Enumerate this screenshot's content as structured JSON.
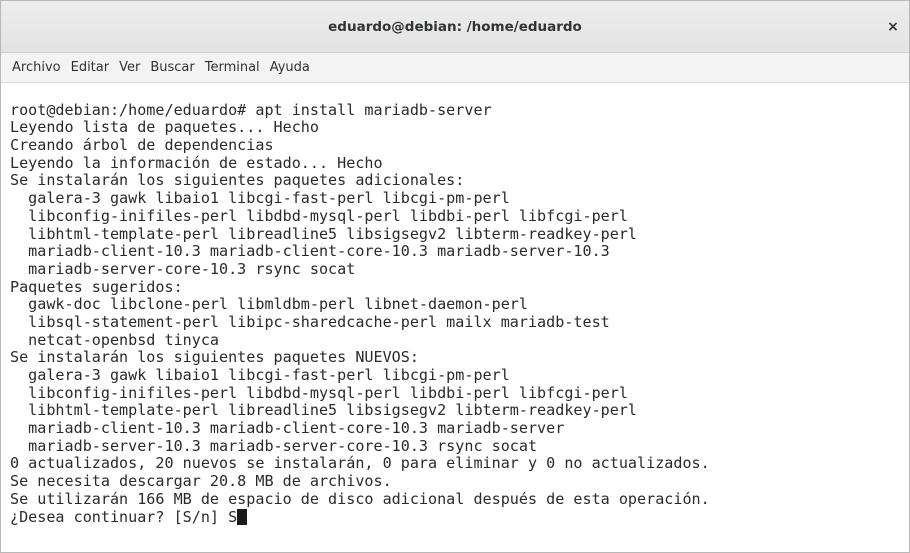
{
  "window": {
    "title": "eduardo@debian: /home/eduardo",
    "close_icon": "close-icon",
    "close_glyph": "×"
  },
  "menu": [
    {
      "label": "Archivo"
    },
    {
      "label": "Editar"
    },
    {
      "label": "Ver"
    },
    {
      "label": "Buscar"
    },
    {
      "label": "Terminal"
    },
    {
      "label": "Ayuda"
    }
  ],
  "terminal": {
    "lines": [
      "root@debian:/home/eduardo# apt install mariadb-server",
      "Leyendo lista de paquetes... Hecho",
      "Creando árbol de dependencias",
      "Leyendo la información de estado... Hecho",
      "Se instalarán los siguientes paquetes adicionales:",
      "  galera-3 gawk libaio1 libcgi-fast-perl libcgi-pm-perl",
      "  libconfig-inifiles-perl libdbd-mysql-perl libdbi-perl libfcgi-perl",
      "  libhtml-template-perl libreadline5 libsigsegv2 libterm-readkey-perl",
      "  mariadb-client-10.3 mariadb-client-core-10.3 mariadb-server-10.3",
      "  mariadb-server-core-10.3 rsync socat",
      "Paquetes sugeridos:",
      "  gawk-doc libclone-perl libmldbm-perl libnet-daemon-perl",
      "  libsql-statement-perl libipc-sharedcache-perl mailx mariadb-test",
      "  netcat-openbsd tinyca",
      "Se instalarán los siguientes paquetes NUEVOS:",
      "  galera-3 gawk libaio1 libcgi-fast-perl libcgi-pm-perl",
      "  libconfig-inifiles-perl libdbd-mysql-perl libdbi-perl libfcgi-perl",
      "  libhtml-template-perl libreadline5 libsigsegv2 libterm-readkey-perl",
      "  mariadb-client-10.3 mariadb-client-core-10.3 mariadb-server",
      "  mariadb-server-10.3 mariadb-server-core-10.3 rsync socat",
      "0 actualizados, 20 nuevos se instalarán, 0 para eliminar y 0 no actualizados.",
      "Se necesita descargar 20.8 MB de archivos.",
      "Se utilizarán 166 MB de espacio de disco adicional después de esta operación."
    ],
    "prompt": "¿Desea continuar? [S/n] ",
    "input_value": "S"
  }
}
